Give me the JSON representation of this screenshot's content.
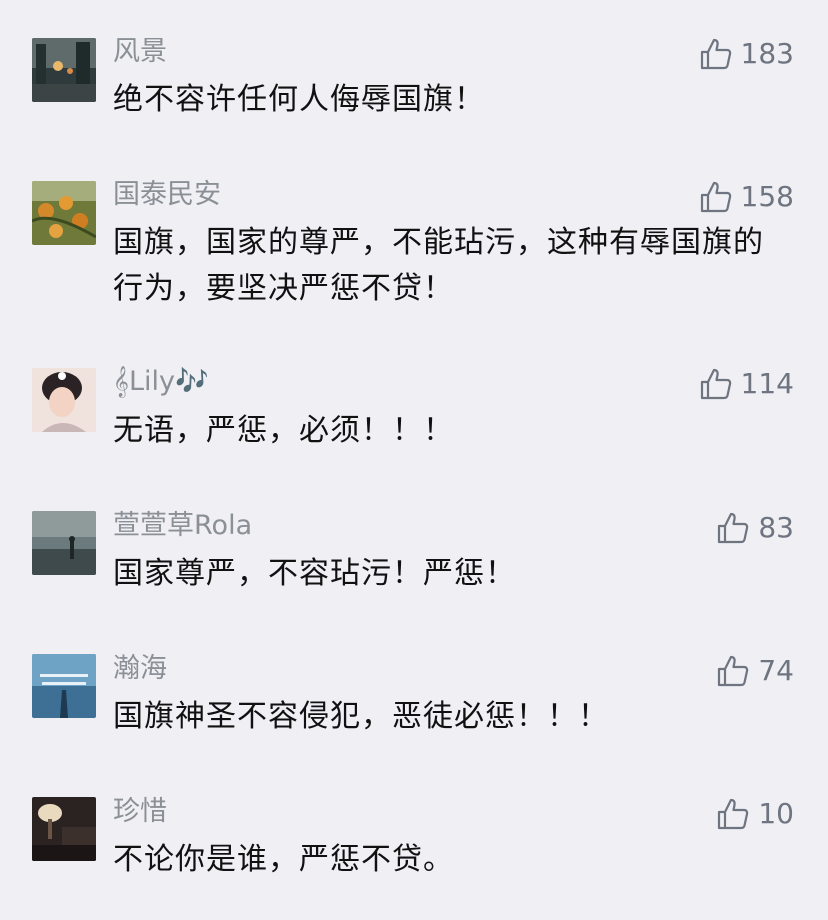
{
  "comments": [
    {
      "name": "风景",
      "likes": "183",
      "text": "绝不容许任何人侮辱国旗！",
      "avatar": "avatar-photo-city-street"
    },
    {
      "name": "国泰民安",
      "likes": "158",
      "text": "国旗，国家的尊严，不能玷污，这种有辱国旗的行为，要坚决严惩不贷！",
      "avatar": "avatar-photo-orange-fruit-tree"
    },
    {
      "name": "𝄞Lily🎶",
      "likes": "114",
      "text": "无语，严惩，必须！！！",
      "avatar": "avatar-photo-woman-portrait"
    },
    {
      "name": "萱萱草Rola",
      "likes": "83",
      "text": "国家尊严，不容玷污！严惩！",
      "avatar": "avatar-photo-person-at-sea"
    },
    {
      "name": "瀚海",
      "likes": "74",
      "text": "国旗神圣不容侵犯，恶徒必惩！！！",
      "avatar": "avatar-photo-blue-sky-with-text"
    },
    {
      "name": "珍惜",
      "likes": "10",
      "text": "不论你是谁，严惩不贷。",
      "avatar": "avatar-photo-dark-room-lamp"
    }
  ],
  "icons": {
    "like": "thumbs-up-icon"
  },
  "colors": {
    "background": "#efeff4",
    "name": "#8b8f96",
    "likes": "#6e7480",
    "text": "#111111"
  }
}
